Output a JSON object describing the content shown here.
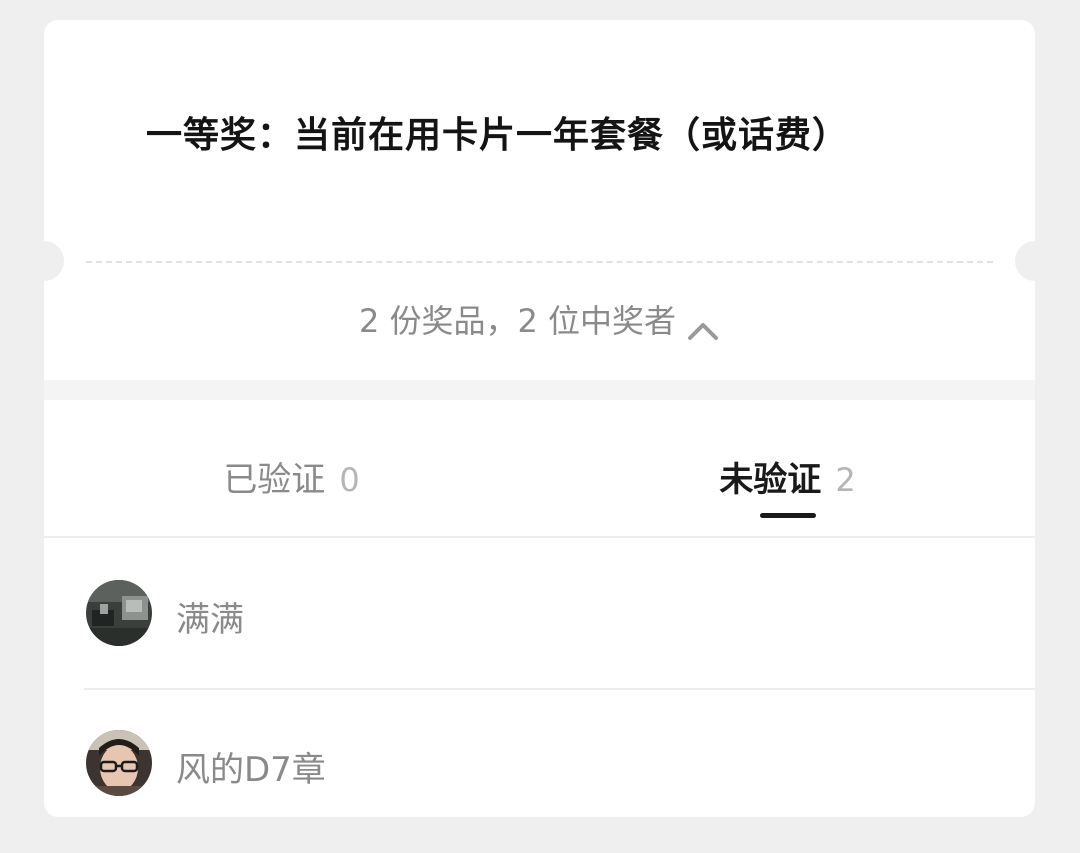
{
  "prize": {
    "title": "一等奖：当前在用卡片一年套餐（或话费）",
    "summary": "2 份奖品，2 位中奖者",
    "summary_icon": "chevron-up-icon"
  },
  "tabs": [
    {
      "label": "已验证",
      "count": "0",
      "active": false
    },
    {
      "label": "未验证",
      "count": "2",
      "active": true
    }
  ],
  "winners": [
    {
      "name": "满满",
      "avatar": "avatar-photo-dark"
    },
    {
      "name": "风的D7章",
      "avatar": "avatar-photo-person-glasses"
    }
  ],
  "colors": {
    "background": "#efefef",
    "card": "#ffffff",
    "title_text": "#141414",
    "muted_text": "#8a8a8a",
    "active_tab": "#1a1a1a",
    "count_text": "#b5b5b5"
  }
}
